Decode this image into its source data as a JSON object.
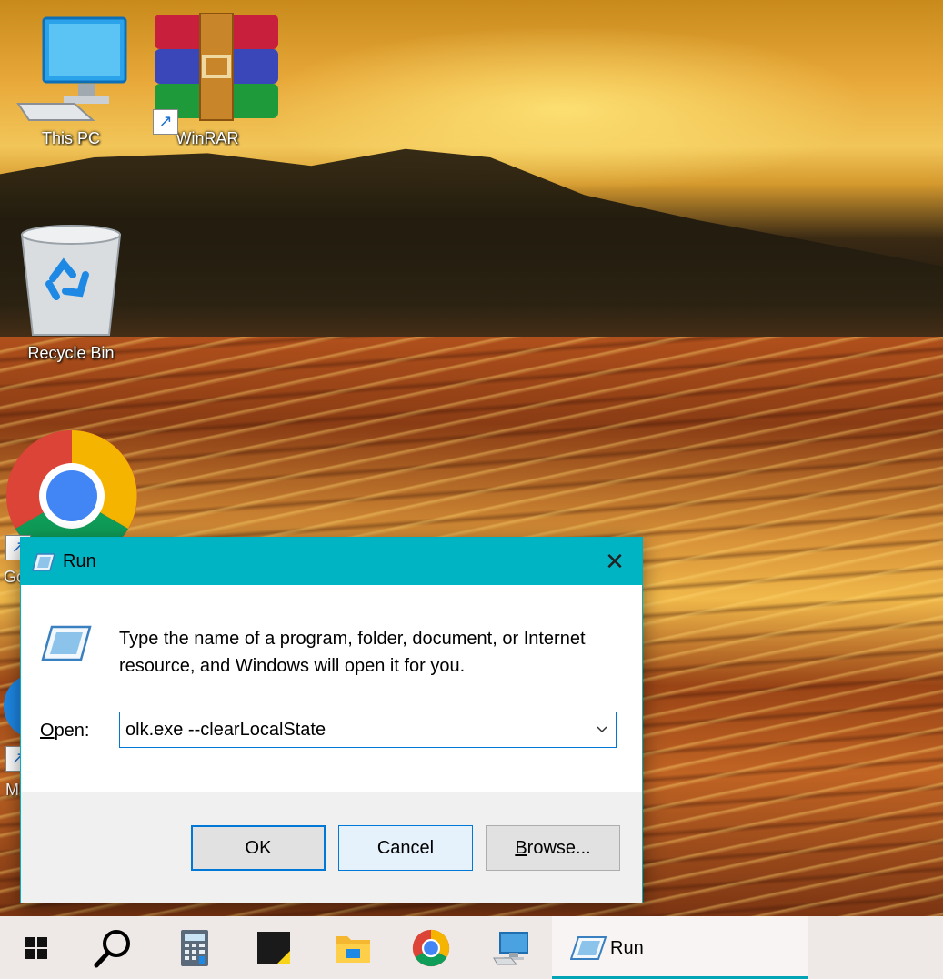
{
  "desktop": {
    "icons": [
      {
        "label": "This PC"
      },
      {
        "label": "WinRAR"
      },
      {
        "label": "Recycle Bin"
      },
      {
        "label": "Go"
      },
      {
        "label": "M"
      }
    ]
  },
  "run_dialog": {
    "title": "Run",
    "close_glyph": "✕",
    "description": "Type the name of a program, folder, document, or Internet resource, and Windows will open it for you.",
    "open_label_accel": "O",
    "open_label_rest": "pen:",
    "open_value": "olk.exe --clearLocalState",
    "buttons": {
      "ok": "OK",
      "cancel": "Cancel",
      "browse_accel": "B",
      "browse_rest": "rowse..."
    }
  },
  "taskbar": {
    "items": [
      "windows-start-icon",
      "search-icon",
      "calculator-icon",
      "sticky-notes-icon",
      "file-explorer-icon",
      "chrome-icon",
      "remote-desktop-icon"
    ],
    "active_window_label": "Run",
    "accent_color": "#00a4b4"
  }
}
